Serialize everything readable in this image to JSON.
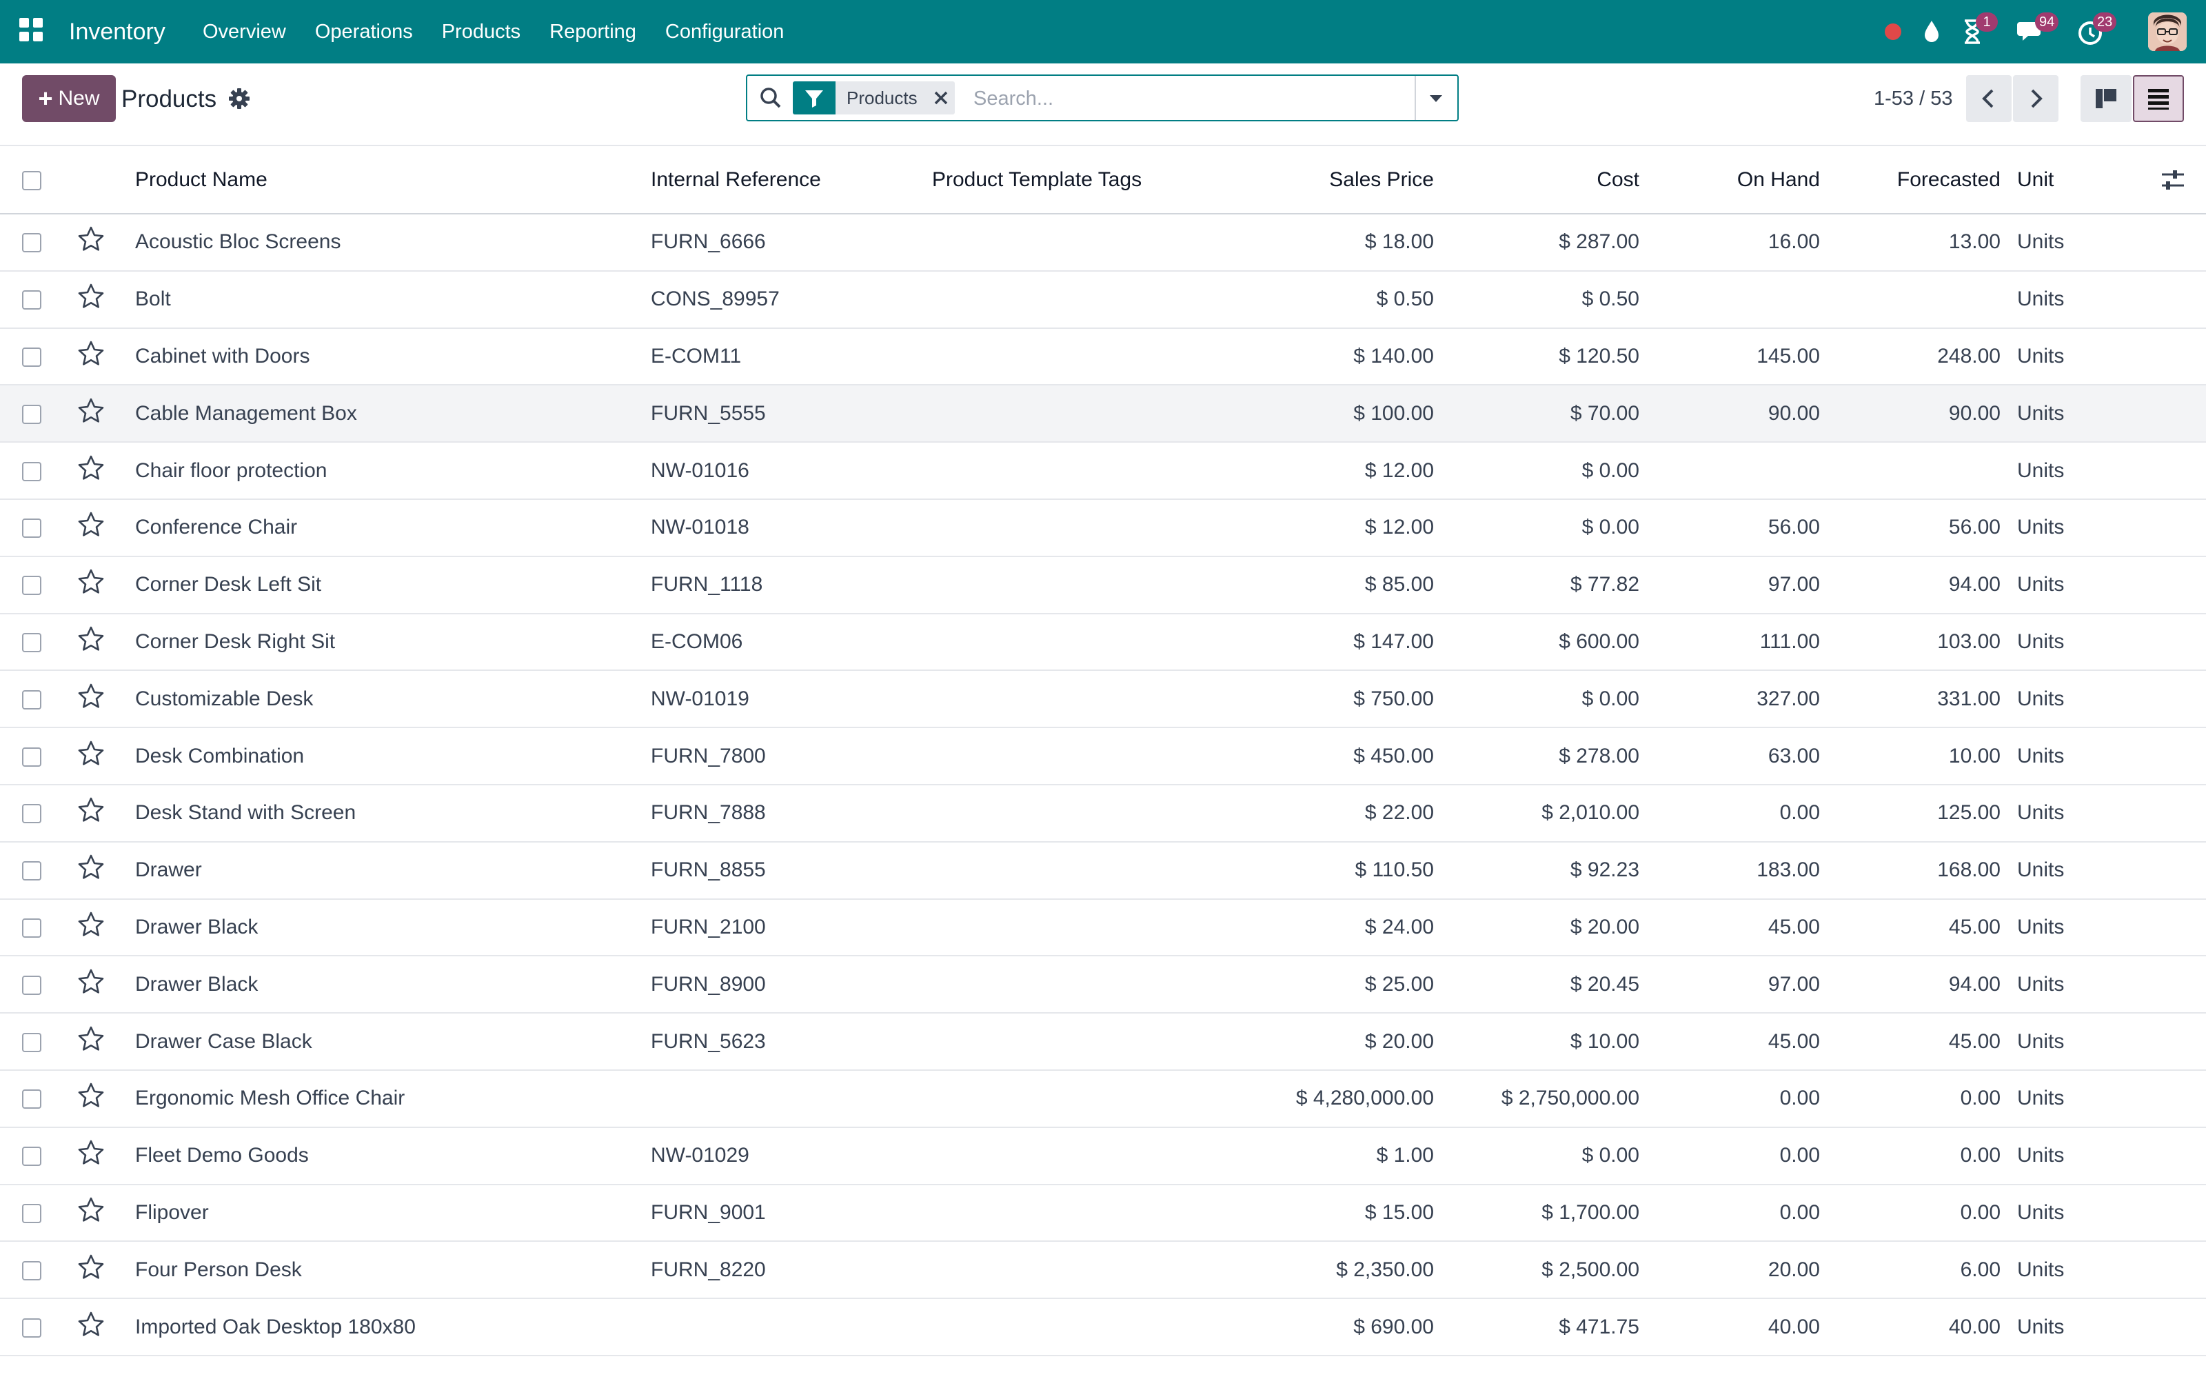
{
  "navbar": {
    "app_name": "Inventory",
    "menu": [
      "Overview",
      "Operations",
      "Products",
      "Reporting",
      "Configuration"
    ],
    "activity_count": "1",
    "messages_count": "94",
    "clock_count": "23",
    "colors": {
      "bar": "#017e84",
      "badge": "#a13b6f",
      "record": "#e04848"
    }
  },
  "control": {
    "new_label": "New",
    "title": "Products",
    "facet_label": "Products",
    "search_placeholder": "Search...",
    "pager": "1-53 / 53"
  },
  "table": {
    "headers": {
      "name": "Product Name",
      "ref": "Internal Reference",
      "tags": "Product Template Tags",
      "price": "Sales Price",
      "cost": "Cost",
      "on_hand": "On Hand",
      "forecasted": "Forecasted",
      "unit": "Unit"
    },
    "rows": [
      {
        "name": "Acoustic Bloc Screens",
        "ref": "FURN_6666",
        "price": "$ 18.00",
        "cost": "$ 287.00",
        "on_hand": "16.00",
        "forecasted": "13.00",
        "unit": "Units"
      },
      {
        "name": "Bolt",
        "ref": "CONS_89957",
        "price": "$ 0.50",
        "cost": "$ 0.50",
        "on_hand": "",
        "forecasted": "",
        "unit": "Units"
      },
      {
        "name": "Cabinet with Doors",
        "ref": "E-COM11",
        "price": "$ 140.00",
        "cost": "$ 120.50",
        "on_hand": "145.00",
        "forecasted": "248.00",
        "unit": "Units"
      },
      {
        "name": "Cable Management Box",
        "ref": "FURN_5555",
        "price": "$ 100.00",
        "cost": "$ 70.00",
        "on_hand": "90.00",
        "forecasted": "90.00",
        "unit": "Units"
      },
      {
        "name": "Chair floor protection",
        "ref": "NW-01016",
        "price": "$ 12.00",
        "cost": "$ 0.00",
        "on_hand": "",
        "forecasted": "",
        "unit": "Units"
      },
      {
        "name": "Conference Chair",
        "ref": "NW-01018",
        "price": "$ 12.00",
        "cost": "$ 0.00",
        "on_hand": "56.00",
        "forecasted": "56.00",
        "unit": "Units"
      },
      {
        "name": "Corner Desk Left Sit",
        "ref": "FURN_1118",
        "price": "$ 85.00",
        "cost": "$ 77.82",
        "on_hand": "97.00",
        "forecasted": "94.00",
        "unit": "Units"
      },
      {
        "name": "Corner Desk Right Sit",
        "ref": "E-COM06",
        "price": "$ 147.00",
        "cost": "$ 600.00",
        "on_hand": "111.00",
        "forecasted": "103.00",
        "unit": "Units"
      },
      {
        "name": "Customizable Desk",
        "ref": "NW-01019",
        "price": "$ 750.00",
        "cost": "$ 0.00",
        "on_hand": "327.00",
        "forecasted": "331.00",
        "unit": "Units"
      },
      {
        "name": "Desk Combination",
        "ref": "FURN_7800",
        "price": "$ 450.00",
        "cost": "$ 278.00",
        "on_hand": "63.00",
        "forecasted": "10.00",
        "unit": "Units"
      },
      {
        "name": "Desk Stand with Screen",
        "ref": "FURN_7888",
        "price": "$ 22.00",
        "cost": "$ 2,010.00",
        "on_hand": "0.00",
        "forecasted": "125.00",
        "unit": "Units"
      },
      {
        "name": "Drawer",
        "ref": "FURN_8855",
        "price": "$ 110.50",
        "cost": "$ 92.23",
        "on_hand": "183.00",
        "forecasted": "168.00",
        "unit": "Units"
      },
      {
        "name": "Drawer Black",
        "ref": "FURN_2100",
        "price": "$ 24.00",
        "cost": "$ 20.00",
        "on_hand": "45.00",
        "forecasted": "45.00",
        "unit": "Units"
      },
      {
        "name": "Drawer Black",
        "ref": "FURN_8900",
        "price": "$ 25.00",
        "cost": "$ 20.45",
        "on_hand": "97.00",
        "forecasted": "94.00",
        "unit": "Units"
      },
      {
        "name": "Drawer Case Black",
        "ref": "FURN_5623",
        "price": "$ 20.00",
        "cost": "$ 10.00",
        "on_hand": "45.00",
        "forecasted": "45.00",
        "unit": "Units"
      },
      {
        "name": "Ergonomic Mesh Office Chair",
        "ref": "",
        "price": "$ 4,280,000.00",
        "cost": "$ 2,750,000.00",
        "on_hand": "0.00",
        "forecasted": "0.00",
        "unit": "Units"
      },
      {
        "name": "Fleet Demo Goods",
        "ref": "NW-01029",
        "price": "$ 1.00",
        "cost": "$ 0.00",
        "on_hand": "0.00",
        "forecasted": "0.00",
        "unit": "Units"
      },
      {
        "name": "Flipover",
        "ref": "FURN_9001",
        "price": "$ 15.00",
        "cost": "$ 1,700.00",
        "on_hand": "0.00",
        "forecasted": "0.00",
        "unit": "Units"
      },
      {
        "name": "Four Person Desk",
        "ref": "FURN_8220",
        "price": "$ 2,350.00",
        "cost": "$ 2,500.00",
        "on_hand": "20.00",
        "forecasted": "6.00",
        "unit": "Units"
      },
      {
        "name": "Imported Oak Desktop 180x80",
        "ref": "",
        "price": "$ 690.00",
        "cost": "$ 471.75",
        "on_hand": "40.00",
        "forecasted": "40.00",
        "unit": "Units"
      }
    ]
  }
}
